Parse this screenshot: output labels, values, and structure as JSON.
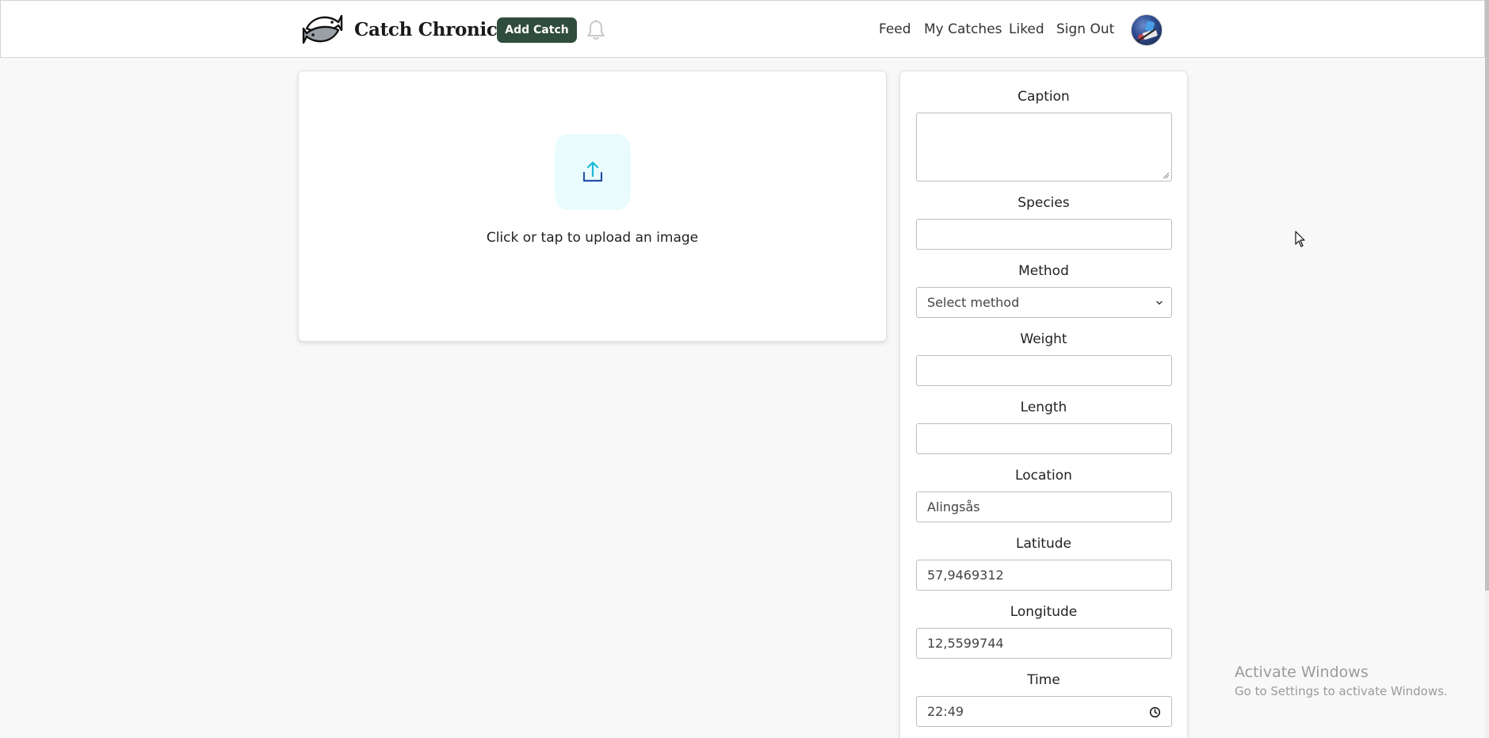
{
  "header": {
    "brand_title": "Catch Chronicle",
    "add_catch_label": "Add Catch",
    "nav": {
      "feed": "Feed",
      "my_catches": "My Catches",
      "liked": "Liked",
      "sign_out": "Sign Out"
    }
  },
  "upload": {
    "prompt": "Click or tap to upload an image"
  },
  "form": {
    "caption": {
      "label": "Caption",
      "value": ""
    },
    "species": {
      "label": "Species",
      "value": ""
    },
    "method": {
      "label": "Method",
      "selected": "Select method"
    },
    "weight": {
      "label": "Weight",
      "value": ""
    },
    "length": {
      "label": "Length",
      "value": ""
    },
    "location": {
      "label": "Location",
      "value": "Alingsås"
    },
    "latitude": {
      "label": "Latitude",
      "value": "57,9469312"
    },
    "longitude": {
      "label": "Longitude",
      "value": "12,5599744"
    },
    "time": {
      "label": "Time",
      "value": "22:49"
    }
  },
  "watermark": {
    "title": "Activate Windows",
    "subtitle": "Go to Settings to activate Windows."
  },
  "icons": {
    "logo": "fish-logo-icon",
    "bell": "bell-icon",
    "upload": "upload-icon",
    "chevron": "chevron-down-icon",
    "clock": "clock-icon"
  },
  "colors": {
    "add_catch_bg": "#304c3c",
    "upload_icon_bg": "#e9fbfd",
    "upload_arrow": "#1bb8d6",
    "upload_tray": "#2a4fa8",
    "page_bg": "#f8f8f8"
  }
}
